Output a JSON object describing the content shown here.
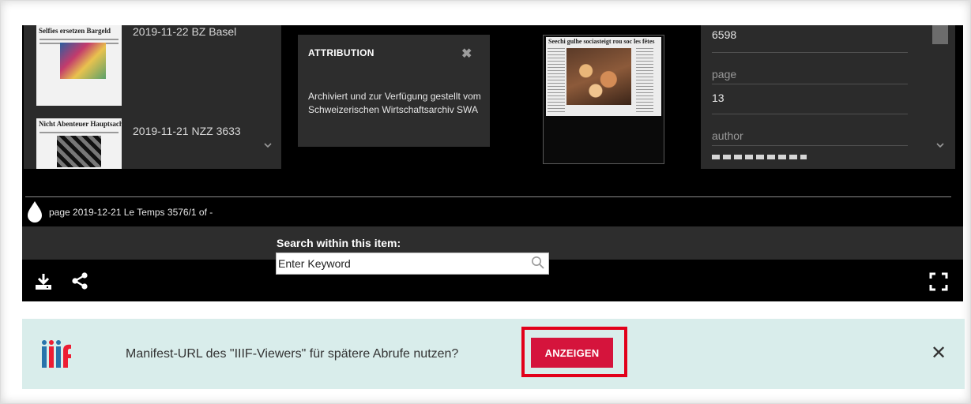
{
  "thumbnails": {
    "items": [
      {
        "label": "2019-11-22 BZ Basel",
        "headline": "Selfies ersetzen Bargeld"
      },
      {
        "label": "2019-11-21 NZZ 3633",
        "headline": "Nicht Abenteuer Hauptsache NZZ Plan"
      }
    ]
  },
  "attribution": {
    "title": "ATTRIBUTION",
    "close_glyph": "✖",
    "body": "Archiviert und zur Verfügung gestellt vom Schweizerischen Wirtschaftsarchiv SWA"
  },
  "page_preview": {
    "headline": "Seechi gulhe sociasteigt rou soc les fêtes"
  },
  "metadata": {
    "value_top": "6598",
    "fields": [
      {
        "key": "page",
        "value": "13"
      },
      {
        "key": "author",
        "value": ""
      }
    ]
  },
  "timeline": {
    "label": "page 2019-12-21 Le Temps 3576/1 of -"
  },
  "search": {
    "label": "Search within this item:",
    "placeholder": "Enter Keyword"
  },
  "banner": {
    "message": "Manifest-URL des \"IIIF-Viewers\" für spätere Abrufe nutzen?",
    "button_label": "ANZEIGEN",
    "close_glyph": "✕",
    "button_color": "#d5143c",
    "highlight_color": "#e2001a",
    "background": "#d9edeb"
  }
}
